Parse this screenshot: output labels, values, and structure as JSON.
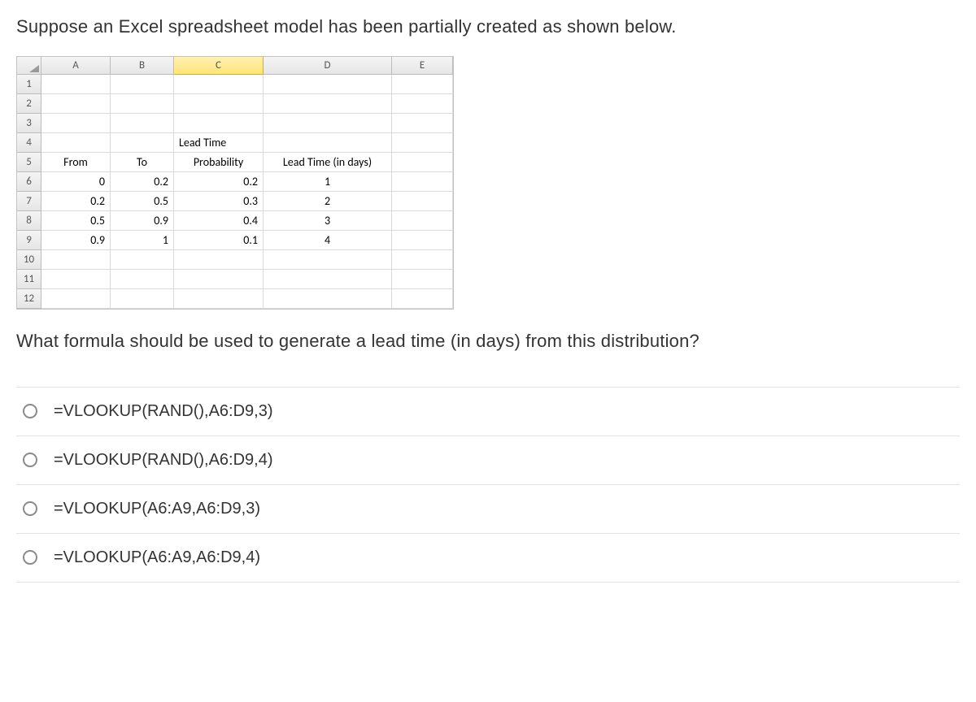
{
  "question_intro": "Suppose an Excel spreadsheet model has been partially created as shown below.",
  "question_ask": "What formula should be used to generate a lead time (in days) from this distribution?",
  "excel": {
    "col_headers": [
      "A",
      "B",
      "C",
      "D",
      "E"
    ],
    "row_headers": [
      "1",
      "2",
      "3",
      "4",
      "5",
      "6",
      "7",
      "8",
      "9",
      "10",
      "11",
      "12"
    ],
    "selected_col_index": 2,
    "rows": {
      "4": {
        "C": "Lead Time"
      },
      "5": {
        "A": "From",
        "B": "To",
        "C": "Probability",
        "D": "Lead Time (in days)"
      },
      "6": {
        "A": "0",
        "B": "0.2",
        "C": "0.2",
        "D": "1"
      },
      "7": {
        "A": "0.2",
        "B": "0.5",
        "C": "0.3",
        "D": "2"
      },
      "8": {
        "A": "0.5",
        "B": "0.9",
        "C": "0.4",
        "D": "3"
      },
      "9": {
        "A": "0.9",
        "B": "1",
        "C": "0.1",
        "D": "4"
      }
    }
  },
  "options": [
    "=VLOOKUP(RAND(),A6:D9,3)",
    "=VLOOKUP(RAND(),A6:D9,4)",
    "=VLOOKUP(A6:A9,A6:D9,3)",
    "=VLOOKUP(A6:A9,A6:D9,4)"
  ]
}
